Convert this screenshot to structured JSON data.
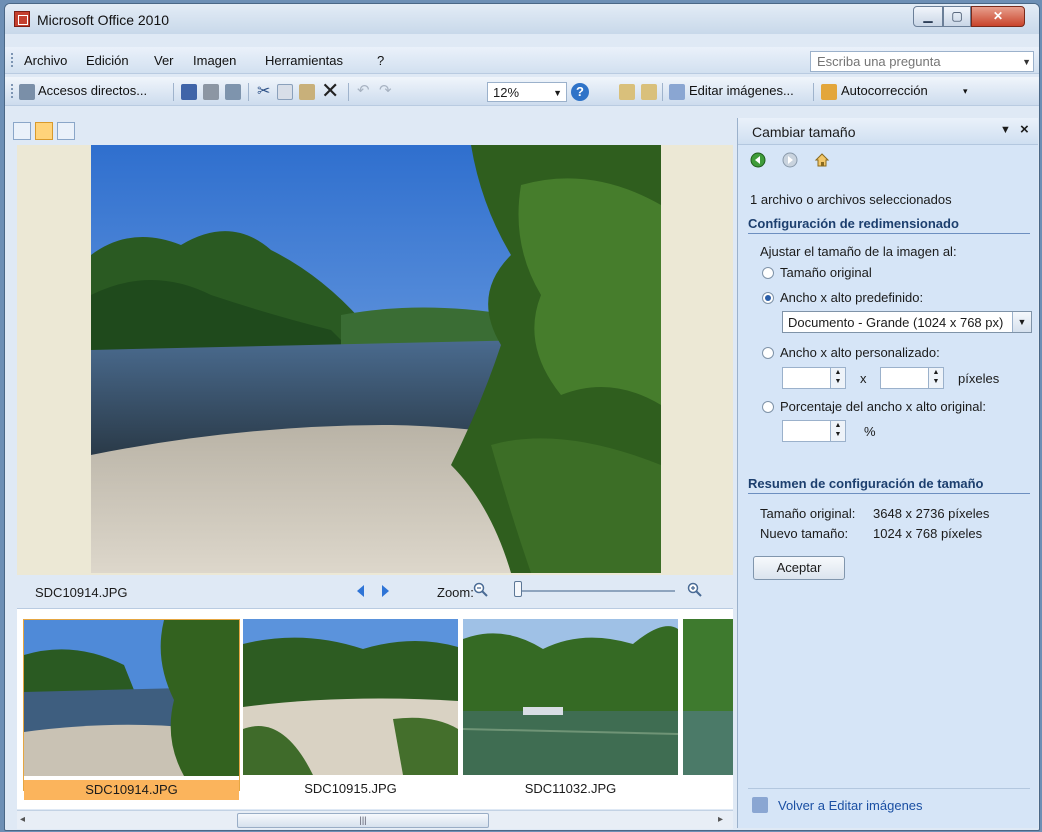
{
  "window": {
    "title": "Microsoft Office 2010"
  },
  "menu": {
    "items": [
      "Archivo",
      "Edición",
      "Ver",
      "Imagen",
      "Herramientas",
      "?"
    ],
    "ask_placeholder": "Escriba una pregunta"
  },
  "toolbar": {
    "shortcuts_label": "Accesos directos...",
    "zoom_value": "12%",
    "edit_images_label": "Editar imágenes...",
    "autocorrect_label": "Autocorrección"
  },
  "viewer": {
    "current_file": "SDC10914.JPG",
    "zoom_label": "Zoom:"
  },
  "filmstrip": {
    "items": [
      "SDC10914.JPG",
      "SDC10915.JPG",
      "SDC11032.JPG"
    ]
  },
  "pane": {
    "title": "Cambiar tamaño",
    "selection_count": "1 archivo o archivos seleccionados",
    "resize_heading": "Configuración de redimensionado",
    "adjust_label": "Ajustar el tamaño de la imagen al:",
    "opt_original": "Tamaño original",
    "opt_predefined": "Ancho x alto predefinido:",
    "predefined_value": "Documento - Grande (1024 x 768 px)",
    "opt_custom": "Ancho x alto personalizado:",
    "custom_x": "x",
    "custom_unit": "píxeles",
    "opt_percent": "Porcentaje del ancho x alto original:",
    "percent_unit": "%",
    "summary_heading": "Resumen de configuración de tamaño",
    "original_size_label": "Tamaño original:",
    "original_size_value": "3648 x 2736 píxeles",
    "new_size_label": "Nuevo tamaño:",
    "new_size_value": "1024 x 768 píxeles",
    "accept_label": "Aceptar",
    "back_link": "Volver a Editar imágenes"
  },
  "colors": {
    "accent": "#2e74d6",
    "selection": "#fbb45c",
    "pane_bg": "#d6e5f7"
  }
}
